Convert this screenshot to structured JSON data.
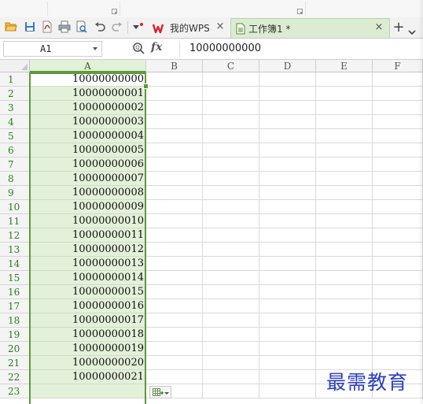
{
  "toolbar": {
    "quick_access_icons": [
      "open-folder-icon",
      "save-icon",
      "export-pdf-icon",
      "print-icon",
      "print-preview-icon",
      "undo-icon",
      "redo-icon",
      "customize-toolbar-icon"
    ]
  },
  "tabs": [
    {
      "label": "我的WPS",
      "icon": "wps-logo-icon",
      "active": false,
      "close": "×"
    },
    {
      "label": "工作簿1 *",
      "icon": "spreadsheet-doc-icon",
      "active": true,
      "close": "×"
    }
  ],
  "tab_controls": {
    "add_label": "+"
  },
  "formula_bar": {
    "name_box": "A1",
    "fx_label": "fx",
    "formula_value": "10000000000"
  },
  "sheet": {
    "columns": [
      "A",
      "B",
      "C",
      "D",
      "E",
      "F"
    ],
    "selected_column": "A",
    "rows": [
      {
        "num": "1",
        "a": "10000000000"
      },
      {
        "num": "2",
        "a": "10000000001"
      },
      {
        "num": "3",
        "a": "10000000002"
      },
      {
        "num": "4",
        "a": "10000000003"
      },
      {
        "num": "5",
        "a": "10000000004"
      },
      {
        "num": "6",
        "a": "10000000005"
      },
      {
        "num": "7",
        "a": "10000000006"
      },
      {
        "num": "8",
        "a": "10000000007"
      },
      {
        "num": "9",
        "a": "10000000008"
      },
      {
        "num": "10",
        "a": "10000000009"
      },
      {
        "num": "11",
        "a": "10000000010"
      },
      {
        "num": "12",
        "a": "10000000011"
      },
      {
        "num": "13",
        "a": "10000000012"
      },
      {
        "num": "14",
        "a": "10000000013"
      },
      {
        "num": "15",
        "a": "10000000014"
      },
      {
        "num": "16",
        "a": "10000000015"
      },
      {
        "num": "17",
        "a": "10000000016"
      },
      {
        "num": "18",
        "a": "10000000017"
      },
      {
        "num": "19",
        "a": "10000000018"
      },
      {
        "num": "20",
        "a": "10000000019"
      },
      {
        "num": "21",
        "a": "10000000020"
      },
      {
        "num": "22",
        "a": "10000000021"
      },
      {
        "num": "23",
        "a": ""
      }
    ]
  },
  "watermark": {
    "text": "最需教育"
  },
  "colors": {
    "selection_green": "#5c9a3a",
    "selection_fill": "#e3f0da",
    "row_number_green": "#2d7d1f",
    "wps_red": "#d9232d",
    "watermark_blue": "#2a3fbf"
  }
}
